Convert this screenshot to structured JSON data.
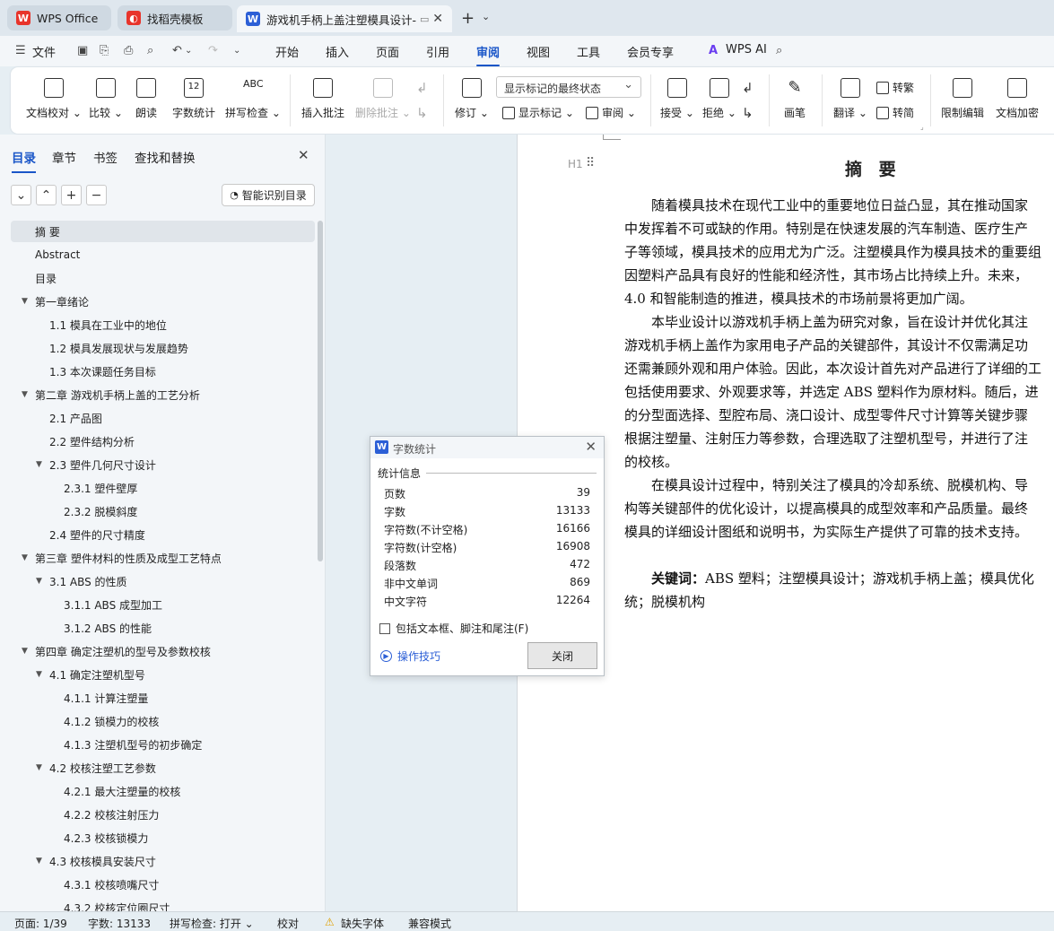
{
  "tabs": [
    {
      "label": "WPS Office",
      "icon": "wps-logo-icon",
      "color": "#e8342b"
    },
    {
      "label": "找稻壳模板",
      "icon": "docer-logo-icon",
      "color": "#e8342b"
    },
    {
      "label": "游戏机手柄上盖注塑模具设计-",
      "icon": "word-doc-icon",
      "color": "#2c5fd6"
    }
  ],
  "menu": {
    "file": "文件",
    "items": [
      "开始",
      "插入",
      "页面",
      "引用",
      "审阅",
      "视图",
      "工具",
      "会员专享"
    ],
    "active": "审阅",
    "ai": "WPS AI"
  },
  "ribbon": {
    "buttons": [
      "文档校对",
      "比较",
      "朗读",
      "字数统计",
      "拼写检查",
      "插入批注",
      "删除批注",
      "修订",
      "接受",
      "拒绝",
      "画笔",
      "限制编辑",
      "文档加密"
    ],
    "revision_state": "显示标记的最终状态",
    "show_markup": "显示标记",
    "review": "审阅",
    "translate": "翻译",
    "to_traditional": "转繁",
    "to_simplified": "转简",
    "wordcount_icon_text": "12",
    "spell_icon_text": "ABC"
  },
  "leftpanel": {
    "tabs": [
      "目录",
      "章节",
      "书签",
      "查找和替换"
    ],
    "smart_button": "智能识别目录",
    "toc": [
      {
        "label": "摘  要",
        "level": 0,
        "arrow": "",
        "selected": true
      },
      {
        "label": "Abstract",
        "level": 0,
        "arrow": ""
      },
      {
        "label": "目录",
        "level": 0,
        "arrow": ""
      },
      {
        "label": "第一章绪论",
        "level": 0,
        "arrow": "▼"
      },
      {
        "label": "1.1 模具在工业中的地位",
        "level": 1,
        "arrow": ""
      },
      {
        "label": "1.2  模具发展现状与发展趋势",
        "level": 1,
        "arrow": ""
      },
      {
        "label": "1.3  本次课题任务目标",
        "level": 1,
        "arrow": ""
      },
      {
        "label": "第二章  游戏机手柄上盖的工艺分析",
        "level": 0,
        "arrow": "▼"
      },
      {
        "label": "2.1  产品图",
        "level": 1,
        "arrow": ""
      },
      {
        "label": "2.2  塑件结构分析",
        "level": 1,
        "arrow": ""
      },
      {
        "label": "2.3  塑件几何尺寸设计",
        "level": 1,
        "arrow": "▼"
      },
      {
        "label": "2.3.1 塑件壁厚",
        "level": 2,
        "arrow": ""
      },
      {
        "label": "2.3.2 脱模斜度",
        "level": 2,
        "arrow": ""
      },
      {
        "label": "2.4  塑件的尺寸精度",
        "level": 1,
        "arrow": ""
      },
      {
        "label": "第三章  塑件材料的性质及成型工艺特点",
        "level": 0,
        "arrow": "▼"
      },
      {
        "label": "3.1 ABS 的性质",
        "level": 1,
        "arrow": "▼"
      },
      {
        "label": "3.1.1 ABS 成型加工",
        "level": 2,
        "arrow": ""
      },
      {
        "label": "3.1.2 ABS 的性能",
        "level": 2,
        "arrow": ""
      },
      {
        "label": "第四章  确定注塑机的型号及参数校核",
        "level": 0,
        "arrow": "▼"
      },
      {
        "label": "4.1 确定注塑机型号",
        "level": 1,
        "arrow": "▼"
      },
      {
        "label": "4.1.1  计算注塑量",
        "level": 2,
        "arrow": ""
      },
      {
        "label": "4.1.2  锁模力的校核",
        "level": 2,
        "arrow": ""
      },
      {
        "label": "4.1.3 注塑机型号的初步确定",
        "level": 2,
        "arrow": ""
      },
      {
        "label": "4.2  校核注塑工艺参数",
        "level": 1,
        "arrow": "▼"
      },
      {
        "label": "4.2.1  最大注塑量的校核",
        "level": 2,
        "arrow": ""
      },
      {
        "label": "4.2.2 校核注射压力",
        "level": 2,
        "arrow": ""
      },
      {
        "label": "4.2.3 校核锁模力",
        "level": 2,
        "arrow": ""
      },
      {
        "label": "4.3  校核模具安装尺寸",
        "level": 1,
        "arrow": "▼"
      },
      {
        "label": "4.3.1  校核喷嘴尺寸",
        "level": 2,
        "arrow": ""
      },
      {
        "label": "4.3.2  校核定位圈尺寸",
        "level": 2,
        "arrow": ""
      }
    ]
  },
  "document": {
    "heading_marker": "H1",
    "title": "摘  要",
    "paragraphs": [
      [
        "　　随着模具技术在现代工业中的重要地位日益凸显，其在推动国家",
        "中发挥着不可或缺的作用。特别是在快速发展的汽车制造、医疗生产",
        "子等领域，模具技术的应用尤为广泛。注塑模具作为模具技术的重要组",
        "因塑料产品具有良好的性能和经济性，其市场占比持续上升。未来，",
        "4.0 和智能制造的推进，模具技术的市场前景将更加广阔。"
      ],
      [
        "　　本毕业设计以游戏机手柄上盖为研究对象，旨在设计并优化其注",
        "游戏机手柄上盖作为家用电子产品的关键部件，其设计不仅需满足功",
        "还需兼顾外观和用户体验。因此，本次设计首先对产品进行了详细的工",
        "包括使用要求、外观要求等，并选定 ABS 塑料作为原材料。随后，进",
        "的分型面选择、型腔布局、浇口设计、成型零件尺寸计算等关键步骤",
        "根据注塑量、注射压力等参数，合理选取了注塑机型号，并进行了注",
        "的校核。"
      ],
      [
        "　　在模具设计过程中，特别关注了模具的冷却系统、脱模机构、导",
        "构等关键部件的优化设计，以提高模具的成型效率和产品质量。最终",
        "模具的详细设计图纸和说明书，为实际生产提供了可靠的技术支持。"
      ]
    ],
    "keywords_label": "关键词：",
    "keywords": [
      "ABS 塑料；注塑模具设计；游戏机手柄上盖；模具优化",
      "统；脱模机构"
    ]
  },
  "dialog": {
    "title": "字数统计",
    "group": "统计信息",
    "stats": [
      {
        "k": "页数",
        "v": "39"
      },
      {
        "k": "字数",
        "v": "13133"
      },
      {
        "k": "字符数(不计空格)",
        "v": "16166"
      },
      {
        "k": "字符数(计空格)",
        "v": "16908"
      },
      {
        "k": "段落数",
        "v": "472"
      },
      {
        "k": "非中文单词",
        "v": "869"
      },
      {
        "k": "中文字符",
        "v": "12264"
      }
    ],
    "checkbox": "包括文本框、脚注和尾注(F)",
    "tips": "操作技巧",
    "close": "关闭"
  },
  "status": {
    "page": "页面: 1/39",
    "words": "字数: 13133",
    "spell": "拼写检查: 打开",
    "proof": "校对",
    "missing_font": "缺失字体",
    "compat": "兼容模式"
  }
}
